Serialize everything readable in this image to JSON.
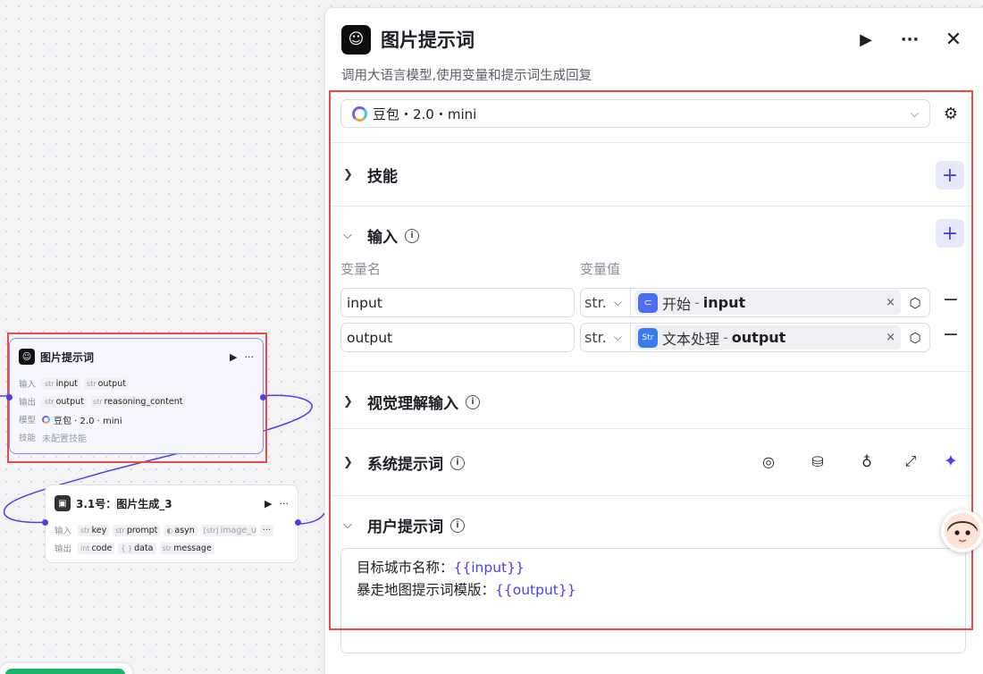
{
  "canvas": {
    "node_llm": {
      "title": "图片提示词",
      "input_label": "输入",
      "inputs": [
        {
          "type": "str",
          "name": "input"
        },
        {
          "type": "str",
          "name": "output"
        }
      ],
      "output_label": "输出",
      "outputs": [
        {
          "type": "str",
          "name": "output"
        },
        {
          "type": "str",
          "name": "reasoning_content"
        }
      ],
      "model_label": "模型",
      "model": "豆包 · 2.0 · mini",
      "skills_label": "技能",
      "skills_value": "未配置技能"
    },
    "node_image": {
      "title": "3.1号：图片生成_3",
      "input_label": "输入",
      "inputs": [
        {
          "type": "str",
          "name": "key"
        },
        {
          "type": "str",
          "name": "prompt"
        },
        {
          "type": "",
          "name": "asyn"
        },
        {
          "type": "[str]",
          "name": "image_url"
        }
      ],
      "more": "···",
      "output_label": "输出",
      "outputs": [
        {
          "type": "int",
          "name": "code"
        },
        {
          "type": "{ }",
          "name": "data"
        },
        {
          "type": "str",
          "name": "message"
        }
      ]
    }
  },
  "panel": {
    "title": "图片提示词",
    "description": "调用大语言模型,使用变量和提示词生成回复",
    "model": "豆包・2.0・mini",
    "sections": {
      "skills": "技能",
      "input": "输入",
      "vision": "视觉理解输入",
      "system_prompt": "系统提示词",
      "user_prompt": "用户提示词"
    },
    "columns": {
      "name": "变量名",
      "value": "变量值"
    },
    "variables": [
      {
        "name": "input",
        "type": "str.",
        "source": "开始",
        "separator": "-",
        "field": "input",
        "icon": "start-icon"
      },
      {
        "name": "output",
        "type": "str.",
        "source": "文本处理",
        "separator": "-",
        "field": "output",
        "icon": "text-process-icon"
      }
    ],
    "user_prompt_lines": [
      {
        "label": "目标城市名称：",
        "var": "{{input}}"
      },
      {
        "label": "暴走地图提示词模版：",
        "var": "{{output}}"
      }
    ]
  },
  "colors": {
    "accent": "#4e40e5",
    "highlight": "#e94b4b",
    "run": "#1bb56a"
  }
}
